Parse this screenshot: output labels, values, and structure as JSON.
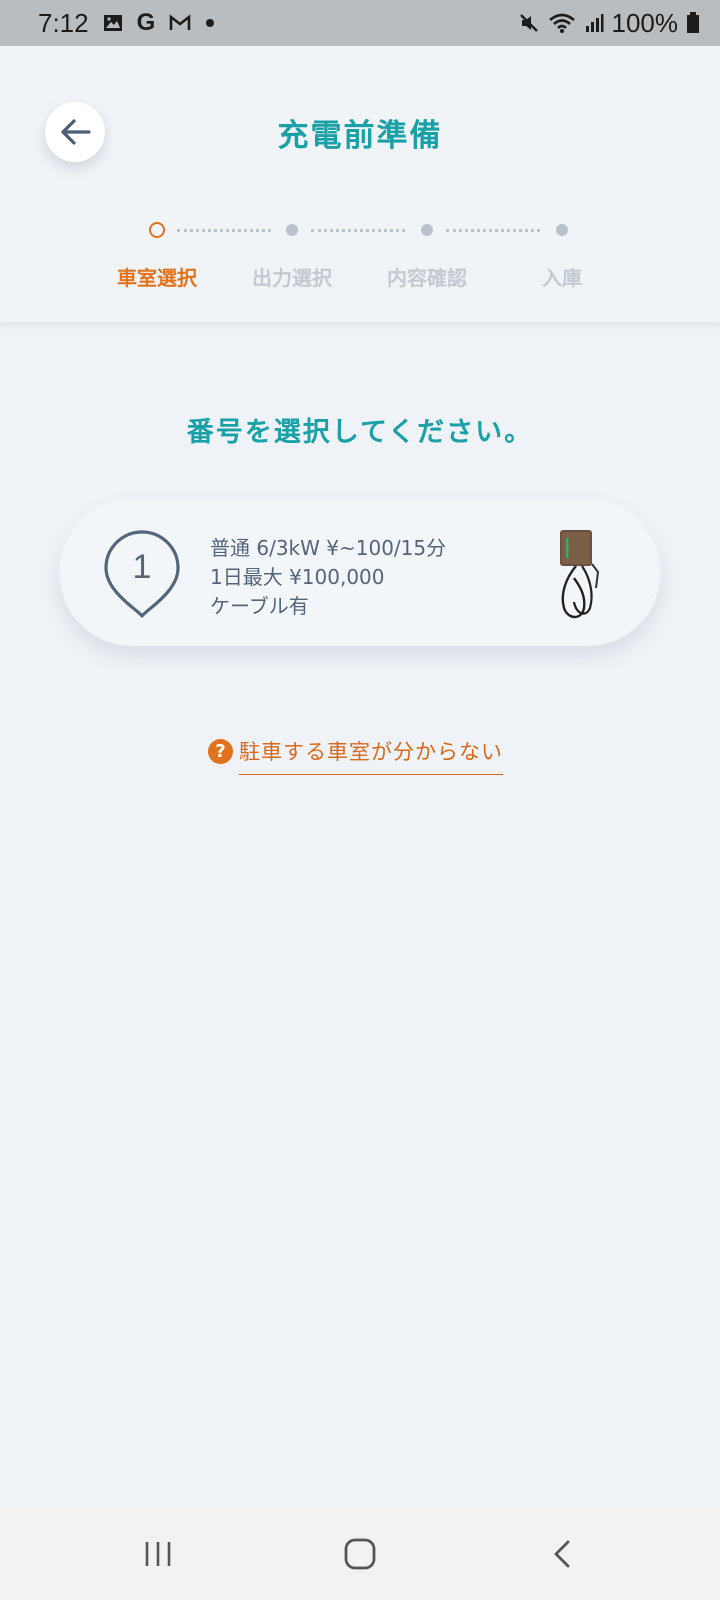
{
  "status_bar": {
    "time": "7:12",
    "left_icons": [
      "gallery-icon",
      "google-icon",
      "gmail-icon",
      "dot-icon"
    ],
    "right_icons": [
      "mute-icon",
      "wifi-icon",
      "signal-icon"
    ],
    "battery": "100%"
  },
  "header": {
    "title": "充電前準備",
    "steps": [
      {
        "label": "車室選択",
        "active": true
      },
      {
        "label": "出力選択",
        "active": false
      },
      {
        "label": "内容確認",
        "active": false
      },
      {
        "label": "入庫",
        "active": false
      }
    ]
  },
  "main": {
    "prompt": "番号を選択してください。",
    "rooms": [
      {
        "number": "1",
        "line1": "普通 6/3kW ¥~100/15分",
        "line2": "1日最大 ¥100,000",
        "line3": "ケーブル有"
      }
    ],
    "help_link": "駐車する車室が分からない"
  },
  "colors": {
    "accent_teal": "#1aa0a7",
    "accent_orange": "#e0731c",
    "background": "#eff3f7"
  }
}
